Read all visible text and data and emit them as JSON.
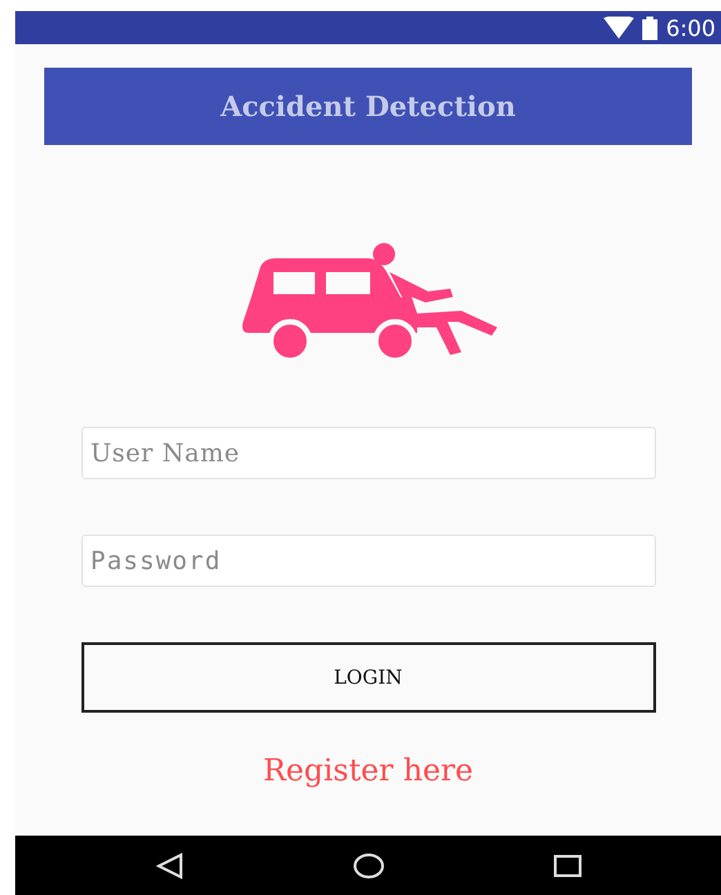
{
  "status_bar": {
    "time": "6:00"
  },
  "title_bar": {
    "title": "Accident Detection"
  },
  "form": {
    "fields": [
      {
        "kind": "text",
        "placeholder": "User Name"
      },
      {
        "kind": "password",
        "placeholder": "Password"
      }
    ],
    "login_button": "LOGIN",
    "register_link": "Register here"
  }
}
